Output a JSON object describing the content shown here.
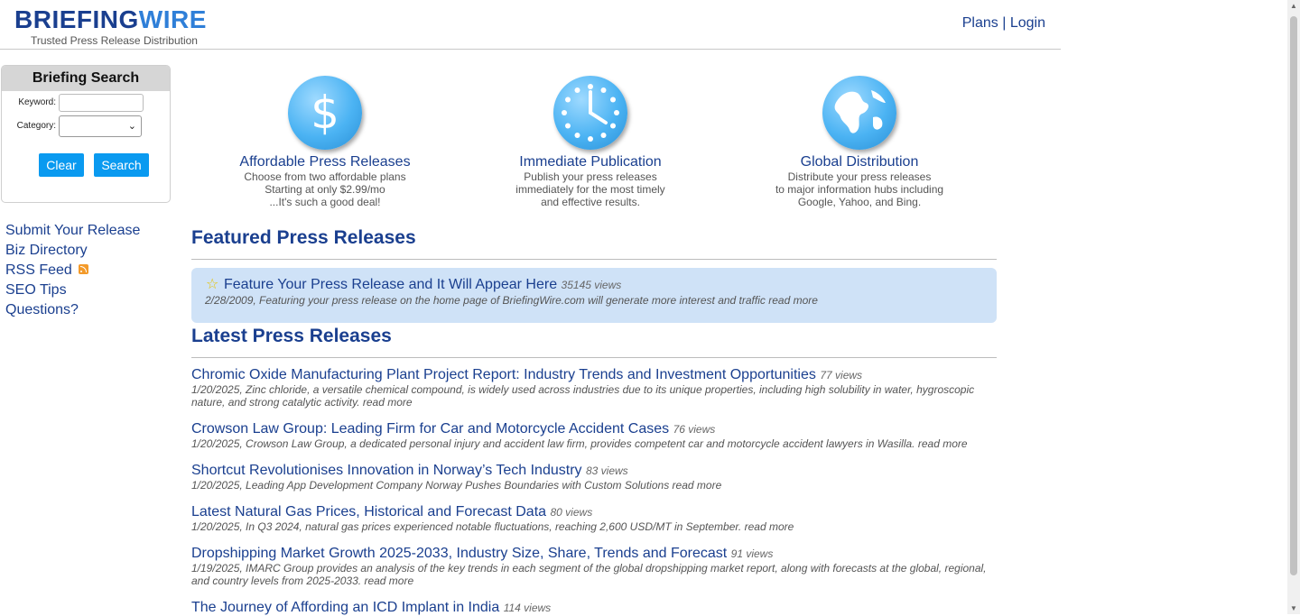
{
  "header": {
    "logo_part1": "BRIEFING",
    "logo_part2": "WIRE",
    "tagline": "Trusted Press Release Distribution",
    "plans": "Plans",
    "separator": "|",
    "login": "Login"
  },
  "search": {
    "title": "Briefing Search",
    "keyword_label": "Keyword:",
    "keyword_value": "",
    "category_label": "Category:",
    "category_value": "",
    "clear": "Clear",
    "search": "Search"
  },
  "leftnav": {
    "submit": "Submit Your Release",
    "biz": "Biz Directory",
    "rss": "RSS Feed",
    "seo": "SEO Tips",
    "questions": "Questions?"
  },
  "features": [
    {
      "title": "Affordable Press Releases",
      "line1": "Choose from two affordable plans",
      "line2": "Starting at only $2.99/mo",
      "line3": "...It's such a good deal!",
      "icon": "dollar-icon"
    },
    {
      "title": "Immediate Publication",
      "line1": "Publish your press releases",
      "line2": "immediately for the most timely",
      "line3": "and effective results.",
      "icon": "clock-icon"
    },
    {
      "title": "Global Distribution",
      "line1": "Distribute your press releases",
      "line2": "to major information hubs including",
      "line3": "Google, Yahoo, and Bing.",
      "icon": "globe-icon"
    }
  ],
  "featured": {
    "heading": "Featured Press Releases",
    "title": "Feature Your Press Release and It Will Appear Here",
    "views": "35145 views",
    "desc": "2/28/2009, Featuring your press release on the home page of BriefingWire.com will generate more interest and traffic",
    "read_more": "read more"
  },
  "latest": {
    "heading": "Latest Press Releases",
    "items": [
      {
        "title": "Chromic Oxide Manufacturing Plant Project Report: Industry Trends and Investment Opportunities",
        "views": "77 views",
        "desc": "1/20/2025, Zinc chloride, a versatile chemical compound, is widely used across industries due to its unique properties, including high solubility in water, hygroscopic nature, and strong catalytic activity.",
        "read_more": "read more"
      },
      {
        "title": "Crowson Law Group: Leading Firm for Car and Motorcycle Accident Cases",
        "views": "76 views",
        "desc": "1/20/2025, Crowson Law Group, a dedicated personal injury and accident law firm, provides competent car and motorcycle accident lawyers in Wasilla.",
        "read_more": "read more"
      },
      {
        "title": "Shortcut Revolutionises Innovation in Norway’s Tech Industry",
        "views": "83 views",
        "desc": "1/20/2025, Leading App Development Company Norway Pushes Boundaries with Custom Solutions",
        "read_more": "read more"
      },
      {
        "title": "Latest Natural Gas Prices, Historical and Forecast Data",
        "views": "80 views",
        "desc": "1/20/2025, In Q3 2024, natural gas prices experienced notable fluctuations, reaching 2,600 USD/MT in September.",
        "read_more": "read more"
      },
      {
        "title": "Dropshipping Market Growth 2025-2033, Industry Size, Share, Trends and Forecast",
        "views": "91 views",
        "desc": "1/19/2025, IMARC Group provides an analysis of the key trends in each segment of the global dropshipping market report, along with forecasts at the global, regional, and country levels from 2025-2033.",
        "read_more": "read more"
      },
      {
        "title": "The Journey of Affording an ICD Implant in India",
        "views": "114 views",
        "desc": "",
        "read_more": ""
      }
    ]
  }
}
